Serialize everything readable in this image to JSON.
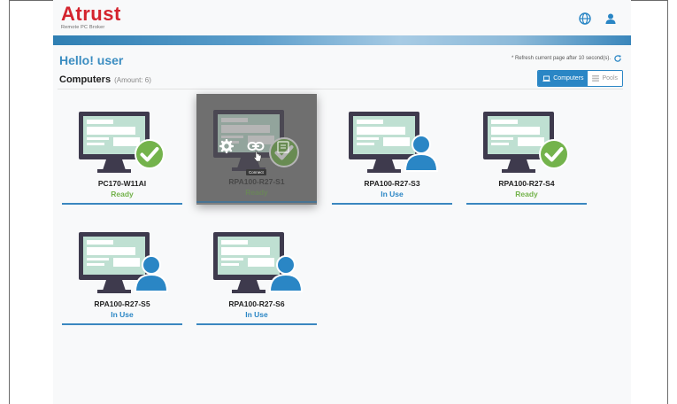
{
  "brand": {
    "name": "Atrust",
    "subtitle": "Remote PC Broker"
  },
  "header": {
    "language_icon": "globe-icon",
    "user_icon": "user-icon"
  },
  "greeting": "Hello!  user",
  "refresh": {
    "text": "* Refresh current page after 10 second(s)."
  },
  "section": {
    "title": "Computers",
    "amount": "(Amount: 6)"
  },
  "view_toggle": {
    "computers_label": "Computers",
    "pools_label": "Pools"
  },
  "hover_tooltip": "Connect",
  "computers": [
    {
      "name": "PC170-W11AI",
      "status": "Ready"
    },
    {
      "name": "RPA100-R27-S1",
      "status": "Ready"
    },
    {
      "name": "RPA100-R27-S3",
      "status": "In Use"
    },
    {
      "name": "RPA100-R27-S4",
      "status": "Ready"
    },
    {
      "name": "RPA100-R27-S5",
      "status": "In Use"
    },
    {
      "name": "RPA100-R27-S6",
      "status": "In Use"
    }
  ],
  "colors": {
    "brand_red": "#d4242e",
    "accent_blue": "#2a86c5",
    "ready_green": "#74b34c",
    "monitor_dark": "#3e3a4d",
    "screen_mint": "#bfe0d2"
  }
}
